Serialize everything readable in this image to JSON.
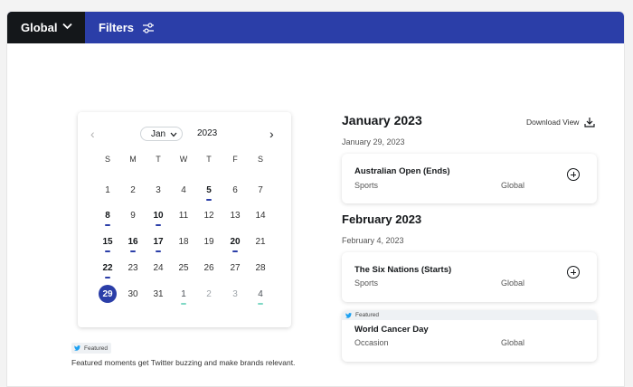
{
  "topbar": {
    "region_label": "Global",
    "filters_label": "Filters"
  },
  "calendar": {
    "prev": "‹",
    "next": "›",
    "month": "Jan",
    "year": "2023",
    "weekdays": [
      "S",
      "M",
      "T",
      "W",
      "T",
      "F",
      "S"
    ],
    "days": [
      {
        "d": "1"
      },
      {
        "d": "2"
      },
      {
        "d": "3"
      },
      {
        "d": "4"
      },
      {
        "d": "5",
        "bold": true,
        "bar": true
      },
      {
        "d": "6"
      },
      {
        "d": "7"
      },
      {
        "d": "8",
        "bold": true,
        "bar": true
      },
      {
        "d": "9"
      },
      {
        "d": "10",
        "bold": true,
        "bar": true
      },
      {
        "d": "11"
      },
      {
        "d": "12"
      },
      {
        "d": "13"
      },
      {
        "d": "14"
      },
      {
        "d": "15",
        "bold": true,
        "bar": true
      },
      {
        "d": "16",
        "bold": true,
        "bar": true
      },
      {
        "d": "17",
        "bold": true,
        "bar": true
      },
      {
        "d": "18"
      },
      {
        "d": "19"
      },
      {
        "d": "20",
        "bold": true,
        "bar": true
      },
      {
        "d": "21"
      },
      {
        "d": "22",
        "bold": true,
        "bar": true
      },
      {
        "d": "23"
      },
      {
        "d": "24"
      },
      {
        "d": "25"
      },
      {
        "d": "26"
      },
      {
        "d": "27"
      },
      {
        "d": "28"
      },
      {
        "d": "29",
        "selected": true
      },
      {
        "d": "30"
      },
      {
        "d": "31"
      },
      {
        "d": "1",
        "first": true,
        "light": true
      },
      {
        "d": "2",
        "muted": true
      },
      {
        "d": "3",
        "muted": true
      },
      {
        "d": "4",
        "first": true,
        "light": true
      }
    ]
  },
  "legend": {
    "badge": "Featured",
    "note": "Featured moments get Twitter buzzing and make brands relevant."
  },
  "download_label": "Download View",
  "months": [
    {
      "heading": "January 2023",
      "date": "January 29, 2023",
      "event": {
        "title": "Australian Open (Ends)",
        "category": "Sports",
        "region": "Global"
      }
    },
    {
      "heading": "February 2023",
      "date": "February 4, 2023",
      "event": {
        "title": "The Six Nations (Starts)",
        "category": "Sports",
        "region": "Global"
      },
      "featured_event": {
        "badge": "Featured",
        "title": "World Cancer Day",
        "category": "Occasion",
        "region": "Global"
      }
    }
  ],
  "colors": {
    "brand": "#2b3ea8",
    "dark": "#14171a",
    "next_month_marker": "#7fd8c5",
    "twitter": "#1da1f2"
  }
}
